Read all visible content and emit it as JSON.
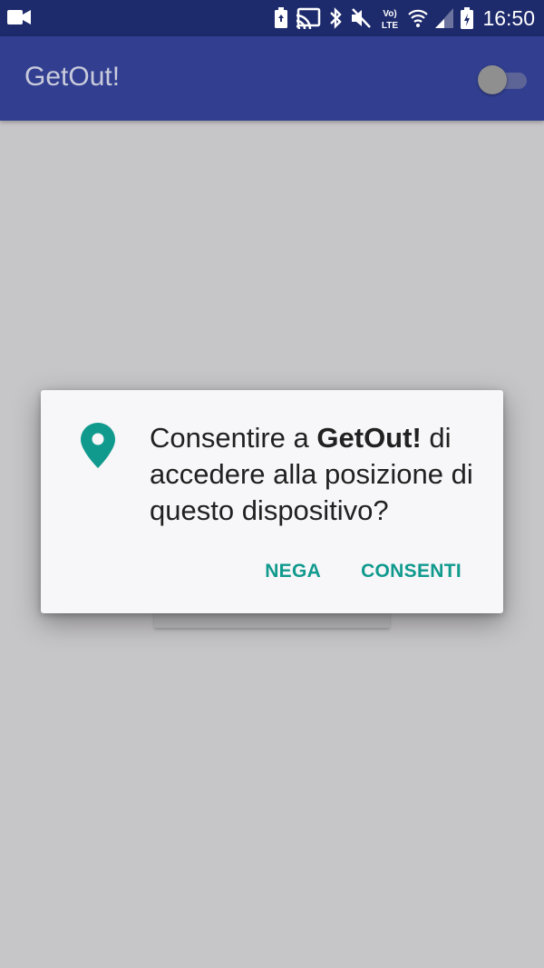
{
  "status_bar": {
    "time": "16:50",
    "icons": [
      "video-camera-icon",
      "battery-saver-icon",
      "cast-icon",
      "bluetooth-icon",
      "mute-icon",
      "volte-icon",
      "wifi-icon",
      "signal-icon",
      "battery-icon"
    ]
  },
  "app_bar": {
    "title": "GetOut!",
    "toggle_state": "off",
    "color": "#323f91"
  },
  "dialog": {
    "icon": "location-pin-icon",
    "message_prefix": "Consentire a ",
    "app_name": "GetOut!",
    "message_suffix": " di accedere alla posizione di questo dispositivo?",
    "deny_label": "NEGA",
    "allow_label": "CONSENTI",
    "accent_color": "#109a8e"
  }
}
